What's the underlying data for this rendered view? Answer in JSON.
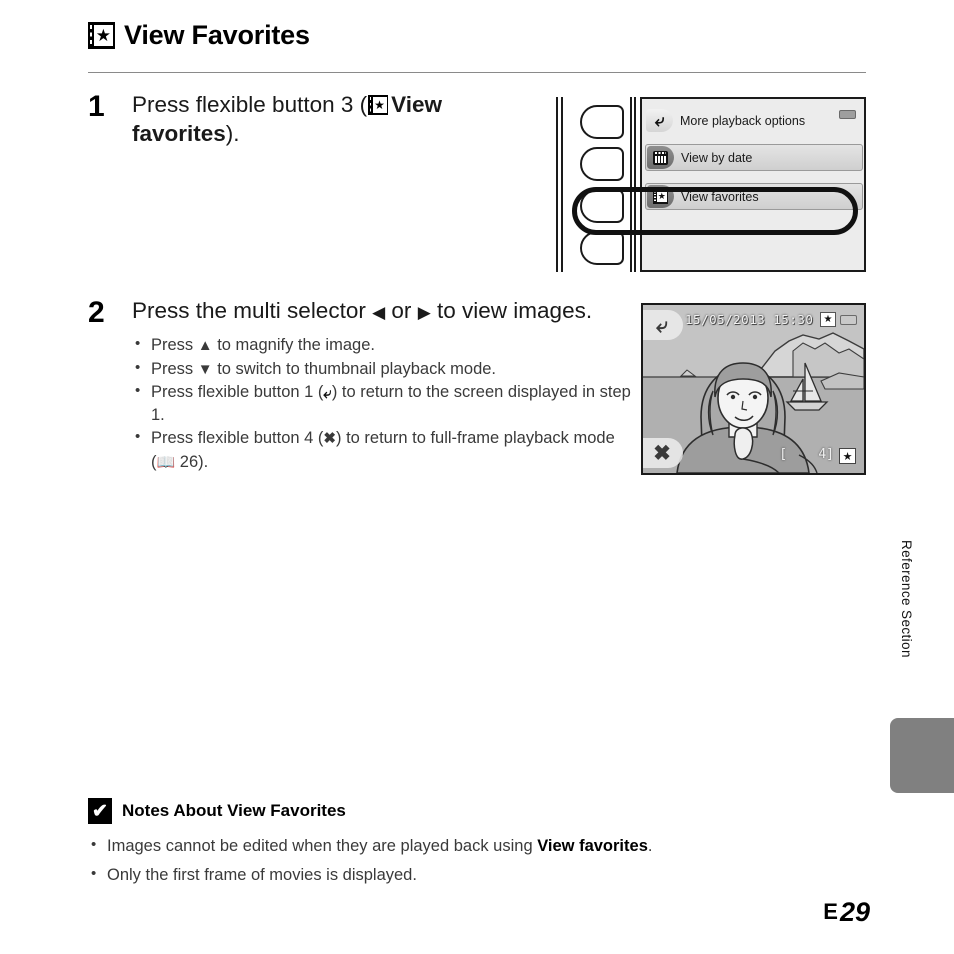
{
  "header": {
    "icon": "view-favorites-icon",
    "title": "View Favorites"
  },
  "steps": [
    {
      "number": "1",
      "text_before": "Press flexible button 3 (",
      "icon": "view-favorites-icon",
      "text_bold": "View favorites",
      "text_after": ")."
    },
    {
      "number": "2",
      "text_a": "Press the multi selector ",
      "icon_left": "◀",
      "text_b": " or ",
      "icon_right": "▶",
      "text_c": " to view images.",
      "bullets": [
        {
          "a": "Press ",
          "glyph": "▲",
          "b": " to magnify the image."
        },
        {
          "a": "Press ",
          "glyph": "▼",
          "b": " to switch to thumbnail playback mode."
        },
        {
          "a": "Press flexible button 1 (",
          "glyph": "back-arrow-icon",
          "b": ") to return to the screen displayed in step 1."
        },
        {
          "a": "Press flexible button 4 (",
          "glyph": "✖",
          "b": ") to return to full-frame playback mode (",
          "ref_icon": "book-icon",
          "ref": " 26)."
        }
      ]
    }
  ],
  "menu_screen": {
    "name": "playback-options-menu",
    "rows": [
      {
        "icon": "back-arrow-icon",
        "label": "More playback options",
        "style": "plain"
      },
      {
        "icon": "calendar-icon",
        "label": "View by date",
        "style": "card"
      },
      {
        "icon": "view-favorites-icon",
        "label": "View favorites",
        "style": "card",
        "highlighted": true
      }
    ],
    "battery_icon": "battery-icon",
    "flexible_buttons": 4,
    "highlighted_button_index": 3
  },
  "photo_screen": {
    "name": "favorites-playback-screen",
    "date": "15/05/2013 15:30",
    "fav_icon_top": "view-favorites-icon",
    "battery_icon": "battery-icon",
    "softkey_top_left": "back-arrow-icon",
    "softkey_bottom_left": "close-icon",
    "counter": "[    4]",
    "fav_icon_bottom": "view-favorites-icon"
  },
  "notes": {
    "icon": "caution-check-icon",
    "heading": "Notes About View Favorites",
    "items": [
      {
        "a": "Images cannot be edited when they are played back using ",
        "bold": "View favorites",
        "b": "."
      },
      {
        "a": "Only the first frame of movies is displayed.",
        "bold": "",
        "b": ""
      }
    ]
  },
  "side_label": "Reference Section",
  "folio": {
    "section_mark": "E",
    "page": "29"
  },
  "colors": {
    "rule": "#8a8a8a",
    "tab": "#808080",
    "screen_bg": "#ececec",
    "photo_bg": "#bdbdbd"
  }
}
